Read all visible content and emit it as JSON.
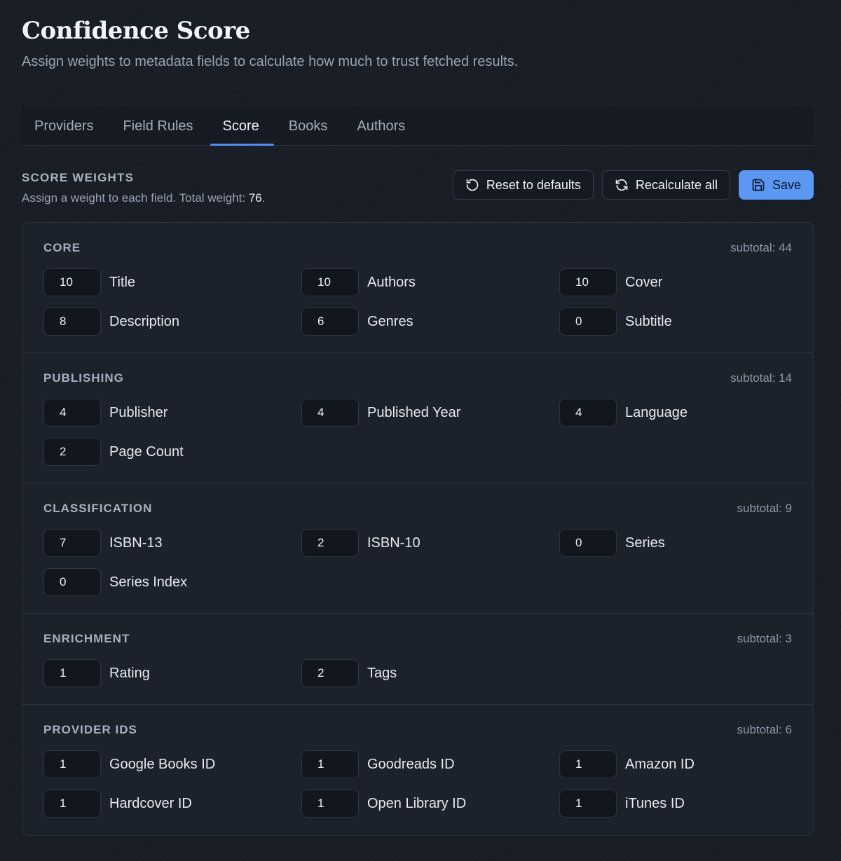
{
  "header": {
    "title": "Confidence Score",
    "subtitle": "Assign weights to metadata fields to calculate how much to trust fetched results."
  },
  "tabs": [
    {
      "label": "Providers"
    },
    {
      "label": "Field Rules"
    },
    {
      "label": "Score",
      "active": true
    },
    {
      "label": "Books"
    },
    {
      "label": "Authors"
    }
  ],
  "section": {
    "title": "SCORE WEIGHTS",
    "desc_prefix": "Assign a weight to each field. Total weight: ",
    "total": "76",
    "desc_suffix": "."
  },
  "actions": {
    "reset_label": "Reset to defaults",
    "recalc_label": "Recalculate all",
    "save_label": "Save"
  },
  "colors": {
    "accent": "#5b98f4",
    "background": "#181d26",
    "card": "#1c222c"
  },
  "groups": [
    {
      "title": "CORE",
      "subtotal": "subtotal: 44",
      "fields": [
        {
          "value": "10",
          "label": "Title"
        },
        {
          "value": "10",
          "label": "Authors"
        },
        {
          "value": "10",
          "label": "Cover"
        },
        {
          "value": "8",
          "label": "Description"
        },
        {
          "value": "6",
          "label": "Genres"
        },
        {
          "value": "0",
          "label": "Subtitle"
        }
      ]
    },
    {
      "title": "PUBLISHING",
      "subtotal": "subtotal: 14",
      "fields": [
        {
          "value": "4",
          "label": "Publisher"
        },
        {
          "value": "4",
          "label": "Published Year"
        },
        {
          "value": "4",
          "label": "Language"
        },
        {
          "value": "2",
          "label": "Page Count"
        }
      ]
    },
    {
      "title": "CLASSIFICATION",
      "subtotal": "subtotal: 9",
      "fields": [
        {
          "value": "7",
          "label": "ISBN-13"
        },
        {
          "value": "2",
          "label": "ISBN-10"
        },
        {
          "value": "0",
          "label": "Series"
        },
        {
          "value": "0",
          "label": "Series Index"
        }
      ]
    },
    {
      "title": "ENRICHMENT",
      "subtotal": "subtotal: 3",
      "fields": [
        {
          "value": "1",
          "label": "Rating"
        },
        {
          "value": "2",
          "label": "Tags"
        }
      ]
    },
    {
      "title": "PROVIDER IDS",
      "subtotal": "subtotal: 6",
      "fields": [
        {
          "value": "1",
          "label": "Google Books ID"
        },
        {
          "value": "1",
          "label": "Goodreads ID"
        },
        {
          "value": "1",
          "label": "Amazon ID"
        },
        {
          "value": "1",
          "label": "Hardcover ID"
        },
        {
          "value": "1",
          "label": "Open Library ID"
        },
        {
          "value": "1",
          "label": "iTunes ID"
        }
      ]
    }
  ]
}
